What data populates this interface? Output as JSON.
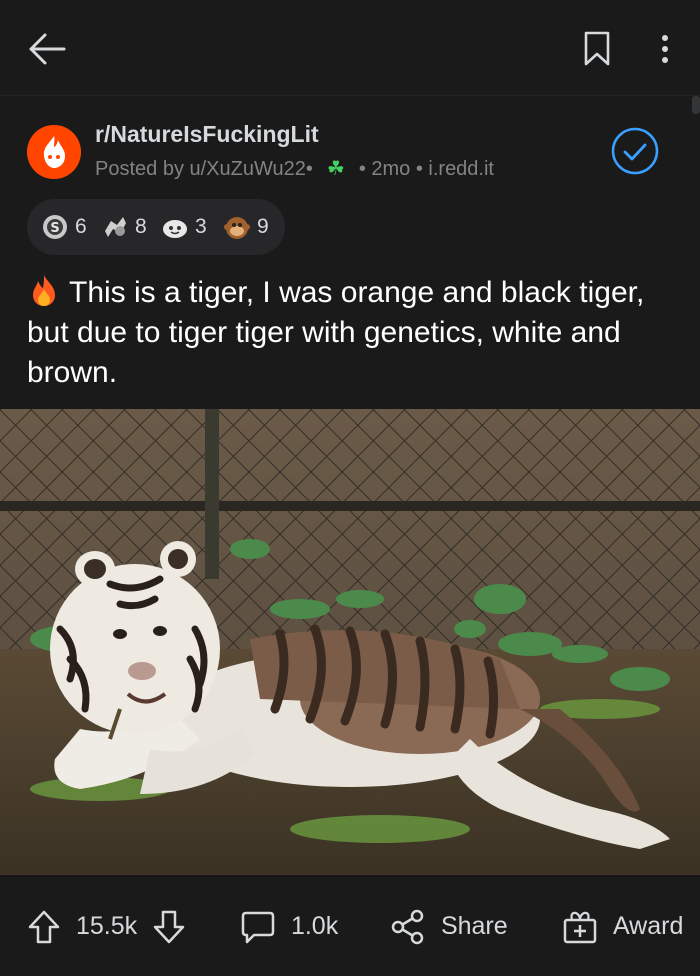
{
  "post": {
    "subreddit": "r/NatureIsFuckingLit",
    "posted_by": "Posted by u/XuZuWu22•",
    "flair_emoji": "☘",
    "age": "• 2mo",
    "domain": "• i.redd.it",
    "title": "This is a tiger, I was orange and black tiger, but due to tiger tiger with genetics, white and brown.",
    "awards": [
      {
        "icon": "silver-award-icon",
        "count": "6"
      },
      {
        "icon": "helpful-award-icon",
        "count": "8"
      },
      {
        "icon": "wholesome-award-icon",
        "count": "3"
      },
      {
        "icon": "monkey-award-icon",
        "count": "9"
      }
    ]
  },
  "actions": {
    "upvotes": "15.5k",
    "comments": "1.0k",
    "share": "Share",
    "award": "Award"
  },
  "colors": {
    "background": "#121212",
    "surface": "#1a1a1b",
    "accent_blue": "#3aa0ff",
    "subreddit_orange": "#ff4500"
  }
}
